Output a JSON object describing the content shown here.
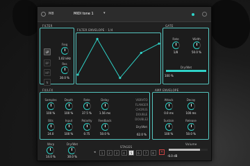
{
  "title_bar": {
    "brand_label": "M8",
    "preset_label": "MIDI tone 1",
    "caret": "▾"
  },
  "filter": {
    "title": "FILTER",
    "modes": [
      "LP",
      "BP",
      "HP",
      "N"
    ],
    "active_mode": "LP",
    "knobs": [
      {
        "label": "Freq",
        "value": "1.02 kHz"
      },
      {
        "label": "Res",
        "value": "30.0 %"
      }
    ]
  },
  "envelope": {
    "title": "FILTER ENVELOPE · 1/4",
    "points": [
      [
        0,
        0.15
      ],
      [
        0.24,
        0.92
      ],
      [
        0.52,
        0.08
      ],
      [
        0.78,
        0.62
      ],
      [
        1,
        0.82
      ]
    ]
  },
  "gate": {
    "title": "GATE",
    "knobs": [
      {
        "label": "Rate",
        "value": "1/8"
      },
      {
        "label": "Width",
        "value": "50.0 %"
      }
    ],
    "drywet_label": "Dry/Wet",
    "drywet_value": "100 %",
    "drywet_fraction": 1.0
  },
  "fx": {
    "title": "FX/LFX",
    "knobs": [
      {
        "label": "Samples",
        "value": "100 %"
      },
      {
        "label": "Depth",
        "value": "100 %"
      },
      {
        "label": "Rate",
        "value": "37.5 %"
      },
      {
        "label": "Delay",
        "value": "1.56 ms"
      },
      {
        "label": "Bits",
        "value": "24.0"
      },
      {
        "label": "Input",
        "value": "100 %"
      },
      {
        "label": "Polarity",
        "value": "0.75"
      },
      {
        "label": "Feedback",
        "value": "50.0 %"
      }
    ],
    "effects": [
      "VIBRATO",
      "FLANGER",
      "CHORUS",
      "DOUBLE",
      "DOUBLE2"
    ],
    "drywet_label": "Dry/Wet",
    "drywet_value": "62.0 %"
  },
  "amp": {
    "title": "AMP ENVELOPE",
    "knobs": [
      {
        "label": "Attack",
        "value": "0.0 ms"
      },
      {
        "label": "Decay",
        "value": "100 ms"
      },
      {
        "label": "Sustain",
        "value": "100 %"
      },
      {
        "label": "Release",
        "value": "50.0 %"
      }
    ]
  },
  "bottom": {
    "knobs": [
      {
        "label": "Warp",
        "value": "14.0 %"
      },
      {
        "label": "Dry/Wet",
        "value": "30.0 %"
      }
    ],
    "steps_title": "STAGES",
    "steps": [
      "1",
      "2",
      "3",
      "4",
      "5",
      "6",
      "7",
      "8"
    ],
    "active_steps": [
      4
    ],
    "volume_label": "Volume",
    "volume_value": "-6.0 dB",
    "volume_fraction": 0.8
  },
  "accent_color": "#2fd3c8"
}
